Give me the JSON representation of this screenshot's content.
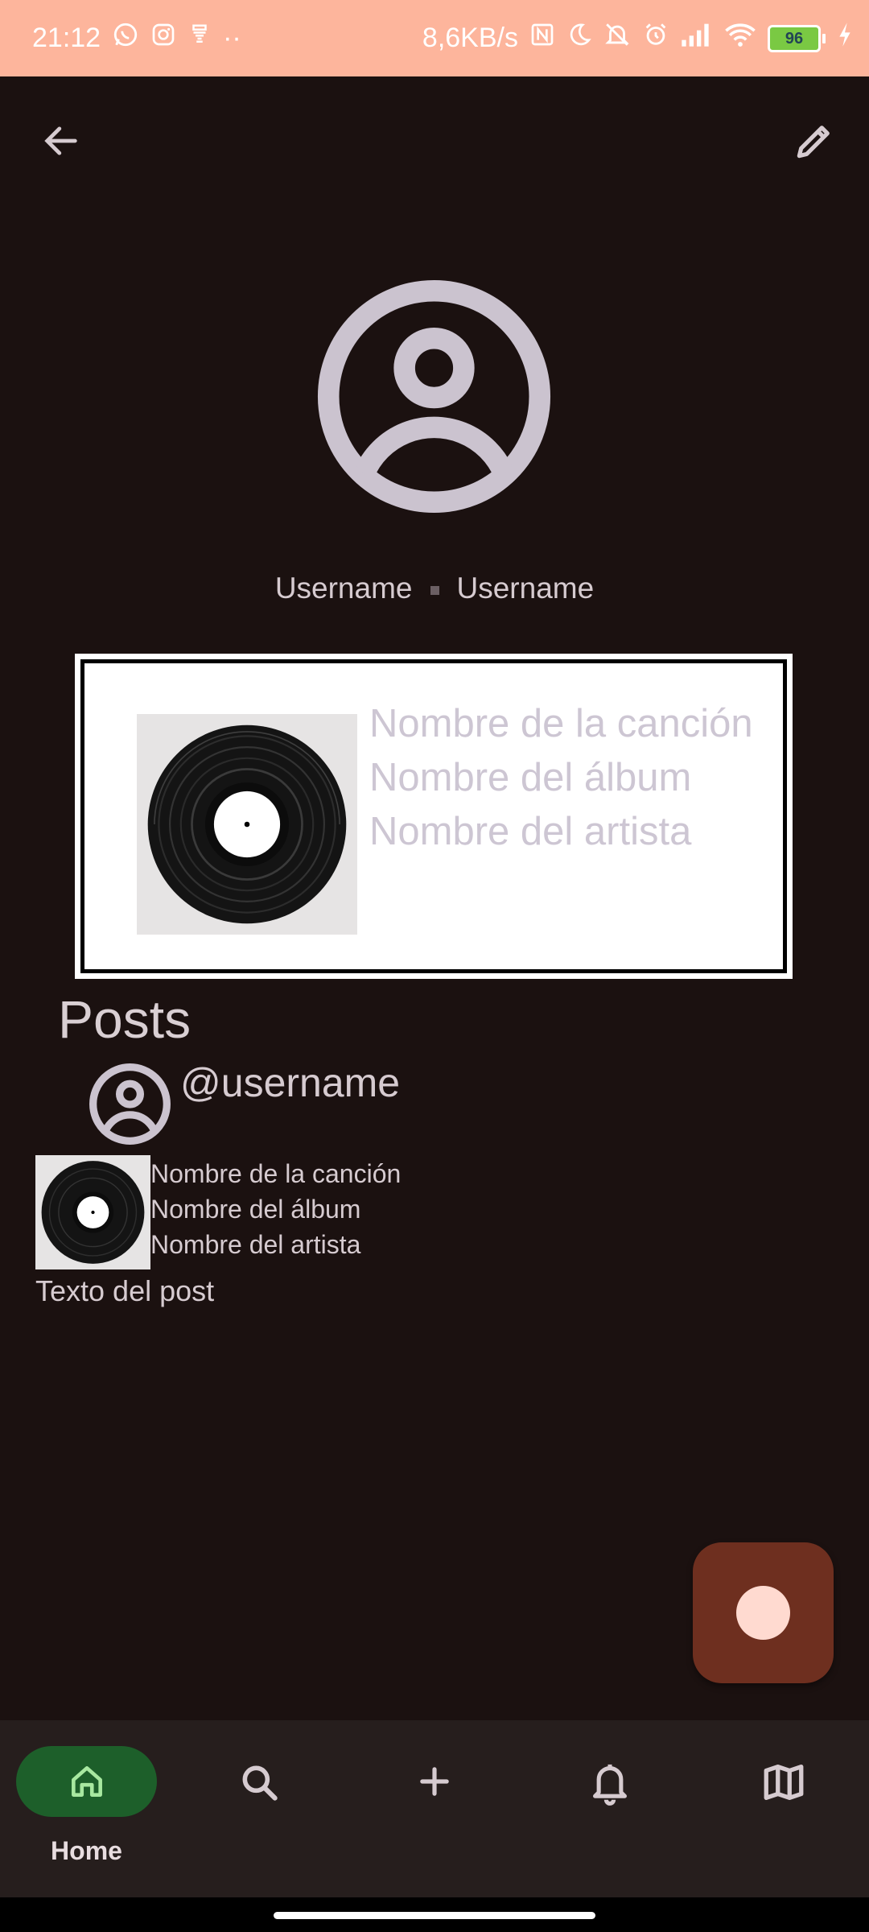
{
  "status_bar": {
    "time": "21:12",
    "speed": "8,6KB/s",
    "battery": "96",
    "dots": "··"
  },
  "profile": {
    "display_name": "Username",
    "username": "Username"
  },
  "favorite_song": {
    "song": "Nombre de la canción",
    "album": "Nombre del álbum",
    "artist": "Nombre del artista"
  },
  "posts": {
    "title": "Posts",
    "items": [
      {
        "handle": "@username",
        "song": "Nombre de la canción",
        "album": "Nombre del álbum",
        "artist": "Nombre del artista",
        "text": "Texto del post"
      }
    ]
  },
  "nav": {
    "home_label": "Home",
    "items": [
      "home-icon",
      "search-icon",
      "add-icon",
      "bell-icon",
      "map-icon"
    ]
  },
  "colors": {
    "status_bar": "#fdb59c",
    "background": "#1b1110",
    "fab": "#6e2f1f",
    "nav_active": "#1d5f2a",
    "accent_text": "#cdc6d3"
  }
}
